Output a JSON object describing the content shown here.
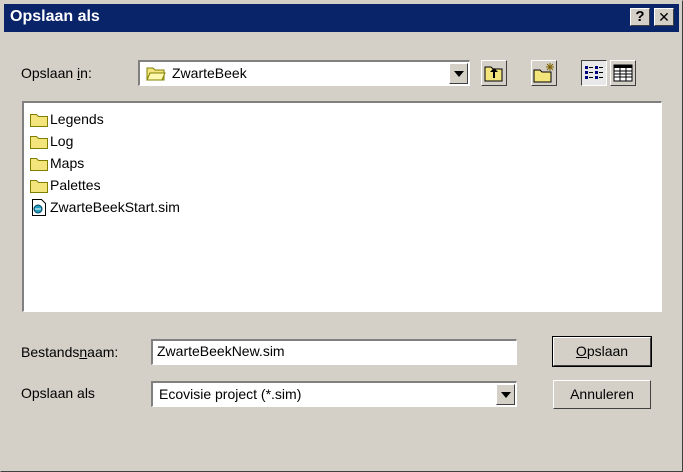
{
  "window": {
    "title": "Opslaan als",
    "help_label": "?",
    "close_label": "✕"
  },
  "location": {
    "label_pre": "Opslaan ",
    "label_accel": "i",
    "label_post": "n:",
    "current_folder": "ZwarteBeek"
  },
  "toolbar": {
    "buttons": [
      "up-one-level",
      "create-new-folder",
      "list-view",
      "details-view"
    ],
    "active_view": "list-view"
  },
  "files": [
    {
      "name": "Legends",
      "type": "folder"
    },
    {
      "name": "Log",
      "type": "folder"
    },
    {
      "name": "Maps",
      "type": "folder"
    },
    {
      "name": "Palettes",
      "type": "folder"
    },
    {
      "name": "ZwarteBeekStart.sim",
      "type": "file"
    }
  ],
  "filename": {
    "label_pre": "Bestands",
    "label_accel": "n",
    "label_post": "aam:",
    "value": "ZwarteBeekNew.sim"
  },
  "filetype": {
    "label": "Opslaan als",
    "selected": "Ecovisie project (*.sim)"
  },
  "buttons": {
    "save_accel": "O",
    "save_rest": "pslaan",
    "cancel": "Annuleren"
  },
  "colors": {
    "titlebar": "#0a246a",
    "face": "#d4d0c8",
    "folder": "#f4e47c"
  }
}
